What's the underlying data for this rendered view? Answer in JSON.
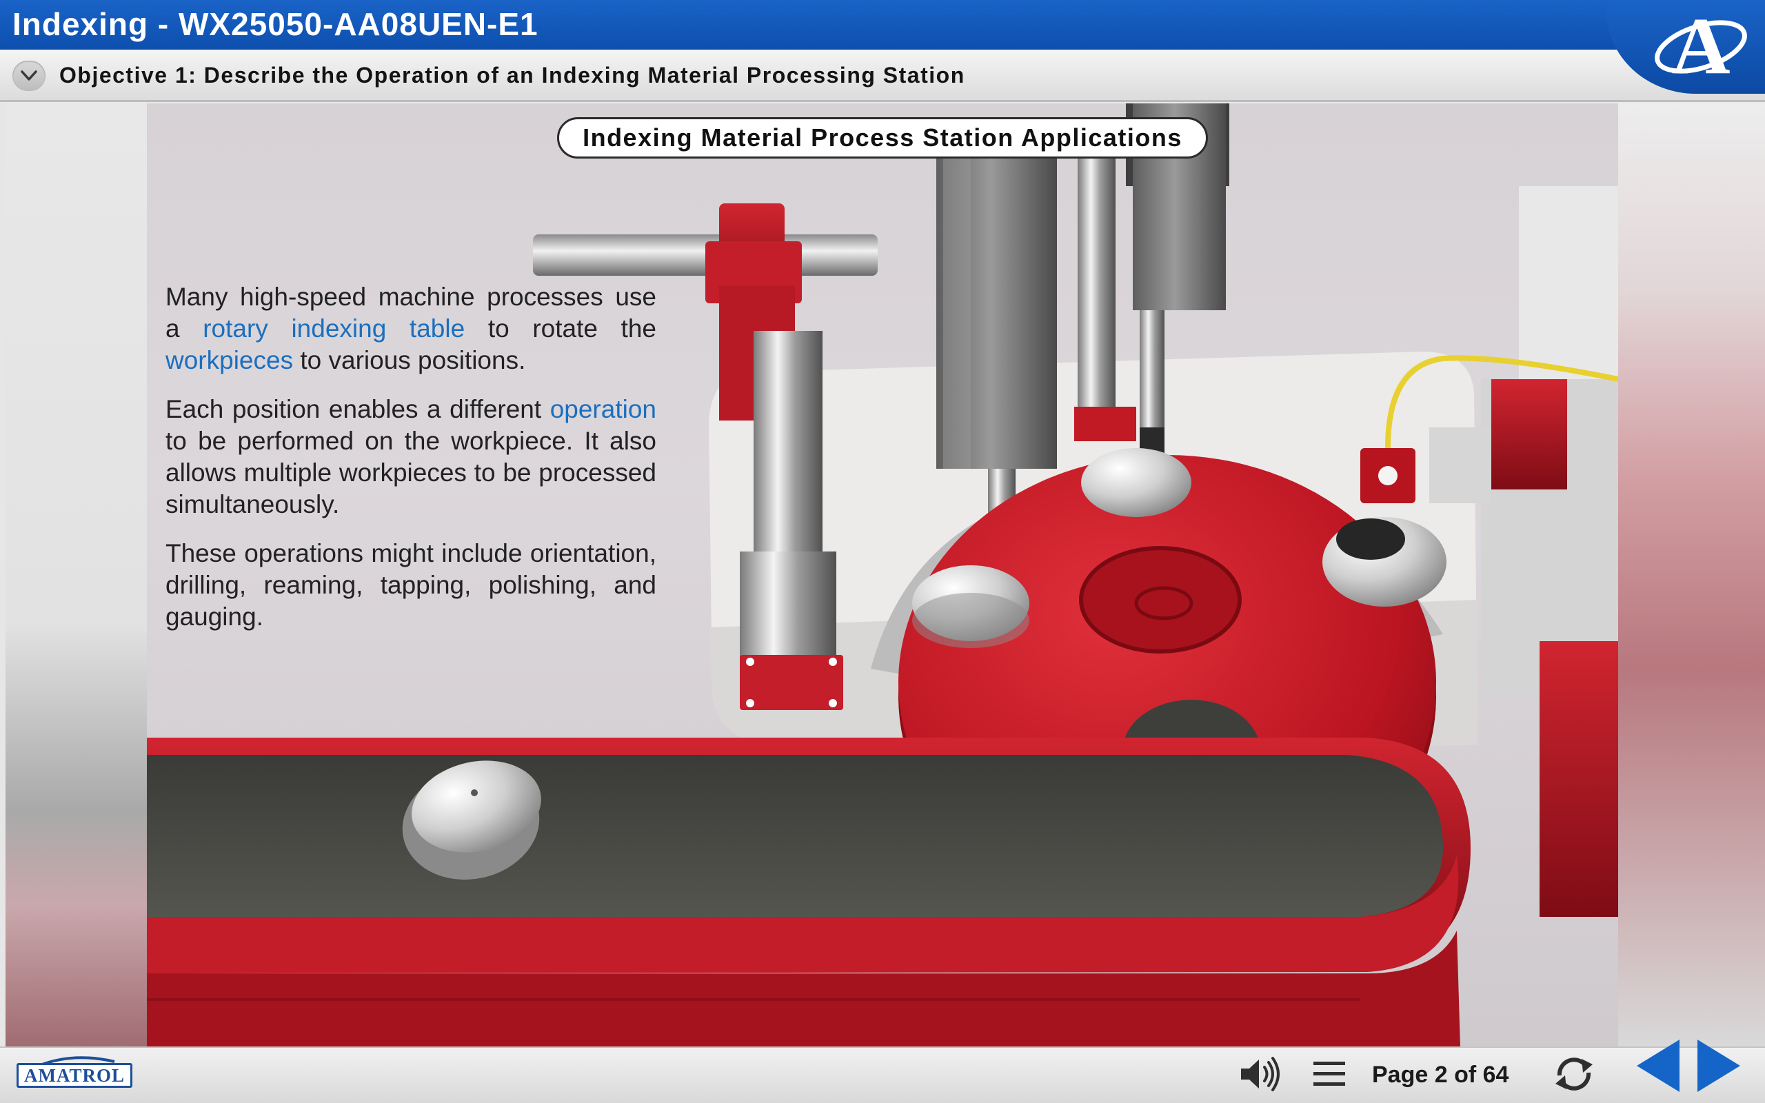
{
  "header": {
    "title": "Indexing - WX25050-AA08UEN-E1",
    "logo_letter": "A"
  },
  "objective": {
    "text": "Objective 1: Describe the Operation of an Indexing Material Processing Station"
  },
  "slide": {
    "title": "Indexing Material Process Station Applications",
    "paragraph1": {
      "part1": "Many high-speed machine processes use a ",
      "link1": "rotary indexing table",
      "part2": " to rotate the ",
      "link2": "workpieces",
      "part3": " to various positions."
    },
    "paragraph2": {
      "part1": "Each position enables a different ",
      "link1": "operation",
      "part2": " to be performed on the workpiece. It also allows multiple workpieces to be processed simultaneously."
    },
    "paragraph3": "These operations might include orientation, drilling, reaming, tapping, polishing, and gauging."
  },
  "footer": {
    "brand": "AMATROL",
    "page_indicator": "Page 2 of 64",
    "icons": [
      "volume-icon",
      "menu-icon",
      "reload-icon",
      "previous-arrow-icon",
      "next-arrow-icon"
    ]
  },
  "colors": {
    "title_bar": "#0d4fae",
    "link": "#1b6fbf",
    "nav_arrow": "#1565c8",
    "machine_red": "#c41e2a"
  }
}
